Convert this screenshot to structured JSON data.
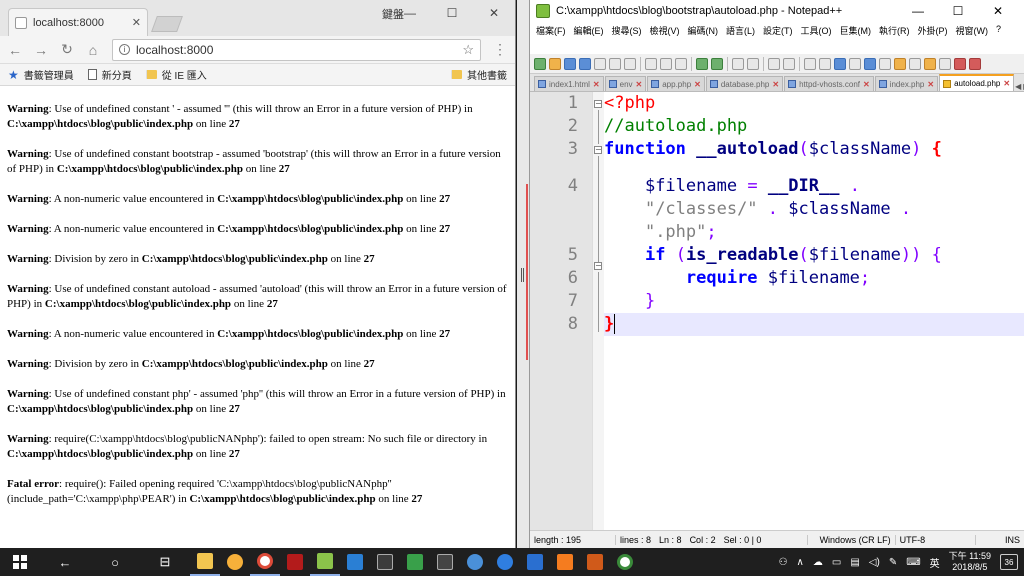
{
  "browser": {
    "tab_title": "localhost:8000",
    "ime_label": "鍵盤",
    "url": "localhost:8000",
    "bookmarks": [
      {
        "label": "書籤管理員",
        "icon": "star-icon"
      },
      {
        "label": "新分頁",
        "icon": "page-icon"
      },
      {
        "label": "從 IE 匯入",
        "icon": "folder-icon"
      }
    ],
    "other_bookmarks": "其他書籤",
    "warnings": [
      {
        "level": "Warning",
        "text": ": Use of undefined constant ' - assumed ''' (this will throw an Error in a future version of PHP) in ",
        "file": "C:\\xampp\\htdocs\\blog\\public\\index.php",
        "on_line": " on line ",
        "line": "27"
      },
      {
        "level": "Warning",
        "text": ": Use of undefined constant bootstrap - assumed 'bootstrap' (this will throw an Error in a future version of PHP) in ",
        "file": "C:\\xampp\\htdocs\\blog\\public\\index.php",
        "on_line": " on line ",
        "line": "27"
      },
      {
        "level": "Warning",
        "text": ": A non-numeric value encountered in ",
        "file": "C:\\xampp\\htdocs\\blog\\public\\index.php",
        "on_line": " on line ",
        "line": "27"
      },
      {
        "level": "Warning",
        "text": ": A non-numeric value encountered in ",
        "file": "C:\\xampp\\htdocs\\blog\\public\\index.php",
        "on_line": " on line ",
        "line": "27"
      },
      {
        "level": "Warning",
        "text": ": Division by zero in ",
        "file": "C:\\xampp\\htdocs\\blog\\public\\index.php",
        "on_line": " on line ",
        "line": "27"
      },
      {
        "level": "Warning",
        "text": ": Use of undefined constant autoload - assumed 'autoload' (this will throw an Error in a future version of PHP) in ",
        "file": "C:\\xampp\\htdocs\\blog\\public\\index.php",
        "on_line": " on line ",
        "line": "27"
      },
      {
        "level": "Warning",
        "text": ": A non-numeric value encountered in ",
        "file": "C:\\xampp\\htdocs\\blog\\public\\index.php",
        "on_line": " on line ",
        "line": "27"
      },
      {
        "level": "Warning",
        "text": ": Division by zero in ",
        "file": "C:\\xampp\\htdocs\\blog\\public\\index.php",
        "on_line": " on line ",
        "line": "27"
      },
      {
        "level": "Warning",
        "text": ": Use of undefined constant php' - assumed 'php'' (this will throw an Error in a future version of PHP) in ",
        "file": "C:\\xampp\\htdocs\\blog\\public\\index.php",
        "on_line": " on line ",
        "line": "27"
      },
      {
        "level": "Warning",
        "text": ": require(C:\\xampp\\htdocs\\blog\\publicNANphp'): failed to open stream: No such file or directory in ",
        "file": "C:\\xampp\\htdocs\\blog\\public\\index.php",
        "on_line": " on line ",
        "line": "27"
      },
      {
        "level": "Fatal error",
        "text": ": require(): Failed opening required 'C:\\xampp\\htdocs\\blog\\publicNANphp'' (include_path='C:\\xampp\\php\\PEAR') in ",
        "file": "C:\\xampp\\htdocs\\blog\\public\\index.php",
        "on_line": " on line ",
        "line": "27"
      }
    ]
  },
  "notepad": {
    "title": "C:\\xampp\\htdocs\\blog\\bootstrap\\autoload.php - Notepad++",
    "menu": [
      "檔案(F)",
      "編輯(E)",
      "搜尋(S)",
      "檢視(V)",
      "編碼(N)",
      "語言(L)",
      "設定(T)",
      "工具(O)",
      "巨集(M)",
      "執行(R)",
      "外掛(P)",
      "視窗(W)",
      "?"
    ],
    "tabs": [
      "index1.html",
      "env",
      "app.php",
      "database.php",
      "httpd-vhosts.conf",
      "index.php",
      "autoload.php"
    ],
    "active_tab": "autoload.php",
    "line_numbers": [
      "1",
      "2",
      "3",
      "4",
      "5",
      "6",
      "7",
      "8"
    ],
    "code": {
      "l1": "<?php",
      "l2": "//autoload.php",
      "l3_kw": "function",
      "l3_fn": "__autoload",
      "l3_p1": "(",
      "l3_var": "$className",
      "l3_p2": ")",
      "l3_brace": "{",
      "l4_var": "$filename",
      "l4_eq": "=",
      "l4_dir": "__DIR__",
      "l4_dot": ".",
      "l4b_str": "\"/classes/\"",
      "l4b_dot": ".",
      "l4b_var": "$className",
      "l4b_dot2": ".",
      "l4c_str": "\".php\"",
      "l4c_semi": ";",
      "l5_kw": "if",
      "l5_p1": "(",
      "l5_fn": "is_readable",
      "l5_p2": "(",
      "l5_var": "$filename",
      "l5_p3": "))",
      "l5_brace": "{",
      "l6_kw": "require",
      "l6_var": "$filename",
      "l6_semi": ";",
      "l7": "}",
      "l8": "}"
    },
    "status": {
      "length": "length : 195",
      "lines": "lines : 8",
      "ln": "Ln : 8",
      "col": "Col : 2",
      "sel": "Sel : 0 | 0",
      "eol": "Windows (CR LF)",
      "enc": "UTF-8",
      "mode": "INS"
    }
  },
  "taskbar": {
    "ime": "英",
    "time": "下午 11:59",
    "date": "2018/8/5",
    "notifications": "36"
  }
}
